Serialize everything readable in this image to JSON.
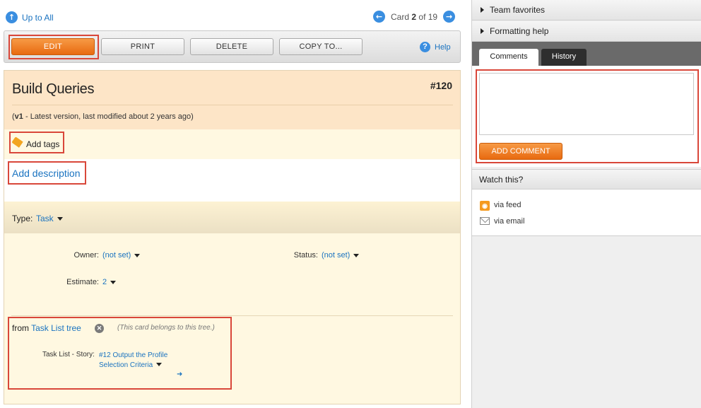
{
  "nav": {
    "up_label": "Up to All",
    "card_prefix": "Card",
    "card_current": "2",
    "card_of": "of 19"
  },
  "toolbar": {
    "edit": "EDIT",
    "print": "PRINT",
    "delete": "DELETE",
    "copy": "COPY TO...",
    "help": "Help"
  },
  "card": {
    "title": "Build Queries",
    "number": "#120",
    "version_bold": "v1",
    "version_rest": " - Latest version, last modified about 2 years ago)",
    "version_open": "(",
    "add_tags": "Add tags",
    "add_description": "Add description",
    "type_label": "Type:",
    "type_value": "Task",
    "properties": {
      "owner_label": "Owner:",
      "owner_value": "(not set)",
      "status_label": "Status:",
      "status_value": "(not set)",
      "estimate_label": "Estimate:",
      "estimate_value": "2"
    },
    "tree": {
      "from": "from",
      "tree_name": "Task List tree",
      "note": "(This card belongs to this tree.)",
      "key": "Task List - Story:",
      "value": "#12 Output the Profile Selection Criteria"
    }
  },
  "sidebar": {
    "team_favorites": "Team favorites",
    "formatting_help": "Formatting help",
    "tabs": {
      "comments": "Comments",
      "history": "History"
    },
    "comment_placeholder": "",
    "add_comment": "ADD COMMENT",
    "watch_title": "Watch this?",
    "via_feed": "via feed",
    "via_email": "via email"
  },
  "colors": {
    "accent_orange": "#e86a10",
    "link_blue": "#1a73c0",
    "highlight_red": "#d9473a"
  }
}
